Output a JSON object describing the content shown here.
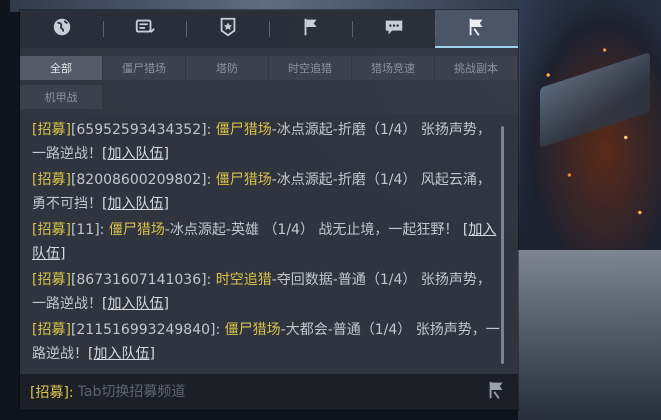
{
  "top_tabs": [
    {
      "name": "globe-icon",
      "active": false
    },
    {
      "name": "team-card-icon",
      "active": false
    },
    {
      "name": "star-badge-icon",
      "active": false
    },
    {
      "name": "flag-icon",
      "active": false
    },
    {
      "name": "chat-bubble-icon",
      "active": false
    },
    {
      "name": "recruit-flag-icon",
      "active": true
    }
  ],
  "sub_tabs": [
    {
      "label": "全部",
      "active": true
    },
    {
      "label": "僵尸猎场",
      "active": false
    },
    {
      "label": "塔防",
      "active": false
    },
    {
      "label": "时空追猎",
      "active": false
    },
    {
      "label": "猎场竞速",
      "active": false
    },
    {
      "label": "挑战副本",
      "active": false
    },
    {
      "label": "机甲战",
      "active": false
    }
  ],
  "messages": [
    {
      "tag": "[招募]",
      "id": "[65952593434352]:",
      "mode": "僵尸猎场",
      "detail": "-冰点源起-折磨（1/4） 张扬声势，一路逆战！",
      "link": "[加入队伍]"
    },
    {
      "tag": "[招募]",
      "id": "[82008600209802]:",
      "mode": "僵尸猎场",
      "detail": "-冰点源起-折磨（1/4） 风起云涌，勇不可挡！",
      "link": "[加入队伍]"
    },
    {
      "tag": "[招募]",
      "id": "[11]:",
      "mode": "僵尸猎场",
      "detail": "-冰点源起-英雄 （1/4） 战无止境，一起狂野！",
      "link": "[加入队伍]"
    },
    {
      "tag": "[招募]",
      "id": "[86731607141036]:",
      "mode": "时空追猎",
      "detail": "-夺回数据-普通（1/4） 张扬声势，一路逆战！",
      "link": "[加入队伍]"
    },
    {
      "tag": "[招募]",
      "id": "[211516993249840]:",
      "mode": "僵尸猎场",
      "detail": "-大都会-普通（1/4） 张扬声势，一路逆战！",
      "link": "[加入队伍]"
    }
  ],
  "input": {
    "tag": "[招募]:",
    "placeholder": "Tab切换招募频道",
    "send_icon": "recruit-flag-icon"
  },
  "colors": {
    "tag": "#d9c34a",
    "active_tab_line": "#9fd3ea"
  }
}
